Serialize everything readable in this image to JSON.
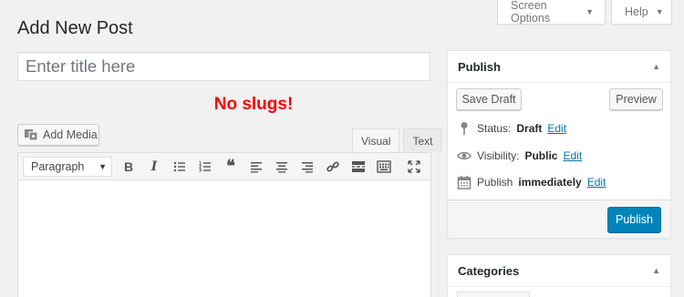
{
  "screen_meta": {
    "screen_options": "Screen Options",
    "help": "Help"
  },
  "page": {
    "title": "Add New Post"
  },
  "title_field": {
    "placeholder": "Enter title here",
    "value": ""
  },
  "notice": {
    "text": "No slugs!",
    "color": "#ff0000"
  },
  "editor": {
    "add_media": "Add Media",
    "tabs": {
      "visual": "Visual",
      "text": "Text",
      "active": "visual"
    },
    "format": "Paragraph",
    "toolbar_icons": [
      "bold-icon",
      "italic-icon",
      "bulleted-list-icon",
      "numbered-list-icon",
      "blockquote-icon",
      "align-left-icon",
      "align-center-icon",
      "align-right-icon",
      "link-icon",
      "read-more-icon",
      "toolbar-toggle-icon",
      "fullscreen-icon"
    ]
  },
  "publish_box": {
    "title": "Publish",
    "save_draft": "Save Draft",
    "preview": "Preview",
    "status": {
      "label": "Status:",
      "value": "Draft",
      "edit": "Edit"
    },
    "visibility": {
      "label": "Visibility:",
      "value": "Public",
      "edit": "Edit"
    },
    "schedule": {
      "label": "Publish",
      "value": "immediately",
      "edit": "Edit"
    },
    "publish_button": "Publish"
  },
  "categories_box": {
    "title": "Categories"
  },
  "colors": {
    "primary": "#0085ba",
    "link": "#0073aa",
    "background": "#f1f1f1"
  }
}
